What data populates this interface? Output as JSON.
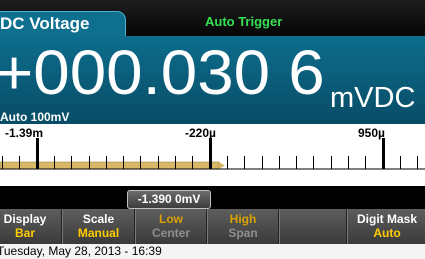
{
  "header": {
    "mode": "DC Voltage",
    "trigger": "Auto Trigger"
  },
  "readout": {
    "value": "+000.030 6",
    "unit": "mVDC",
    "range": "Auto 100mV"
  },
  "bar_graph": {
    "tick_labels": [
      "-1.39m",
      "-220µ",
      "950µ"
    ],
    "fill_fraction": 0.52,
    "cursor_value": "-1.390 0mV"
  },
  "softkeys": [
    {
      "top": "Display",
      "bottom": "Bar"
    },
    {
      "top": "Scale",
      "bottom": "Manual"
    },
    {
      "top": "Low",
      "bottom": "Center"
    },
    {
      "top": "High",
      "bottom": "Span"
    },
    {
      "top": "",
      "bottom": ""
    },
    {
      "top": "Digit Mask",
      "bottom": "Auto"
    }
  ],
  "status": {
    "datetime": "Tuesday, May 28, 2013 - 16:39"
  },
  "colors": {
    "panel": "#0d6d8d",
    "trigger": "#35e055",
    "softkey_value": "#ffcc00",
    "bar_fill": "#d7b766"
  }
}
